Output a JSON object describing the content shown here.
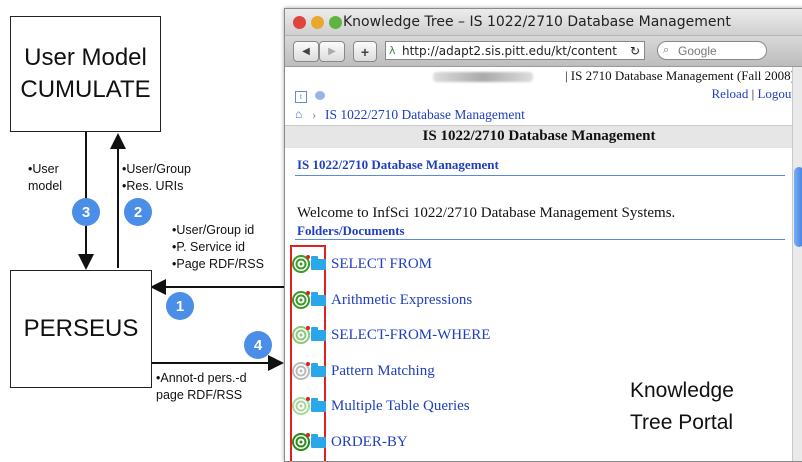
{
  "user_model": {
    "line1": "User Model",
    "line2": "CUMULATE"
  },
  "perseus": {
    "label": "PERSEUS"
  },
  "labels": {
    "user_model": "•User\nmodel",
    "user_group_res": "•User/Group\n•Res. URIs",
    "request": "•User/Group id\n•P. Service id\n•Page RDF/RSS",
    "annotated": "•Annot-d pers.-d\npage RDF/RSS"
  },
  "badges": [
    "1",
    "2",
    "3",
    "4"
  ],
  "portal_caption": {
    "line1": "Knowledge",
    "line2": "Tree Portal"
  },
  "browser": {
    "title": "Knowledge Tree – IS 1022/2710 Database Management",
    "url": "http://adapt2.sis.pitt.edu/kt/content",
    "search_placeholder": "Google",
    "course_header": "| IS 2710 Database Management (Fall 2008)",
    "reload": "Reload",
    "logout": "Logout",
    "separator": "|",
    "breadcrumb": "IS 1022/2710 Database Management",
    "page_title": "IS 1022/2710 Database Management",
    "section_title": "IS 1022/2710 Database Management",
    "welcome": "Welcome to InfSci 1022/2710 Database Management Systems.",
    "folders_title": "Folders/Documents",
    "items": [
      {
        "label": "SELECT FROM",
        "color": "#3a9a2a"
      },
      {
        "label": "Arithmetic Expressions",
        "color": "#3a9a2a"
      },
      {
        "label": "SELECT-FROM-WHERE",
        "color": "#8cc87a"
      },
      {
        "label": "Pattern Matching",
        "color": "#bbbbbb"
      },
      {
        "label": "Multiple Table Queries",
        "color": "#a6d89a"
      },
      {
        "label": "ORDER-BY",
        "color": "#2a8a1a"
      }
    ]
  },
  "colors": {
    "badge": "#4a8ee8",
    "highlight_box": "#e02020",
    "link": "#1f3fbf"
  }
}
